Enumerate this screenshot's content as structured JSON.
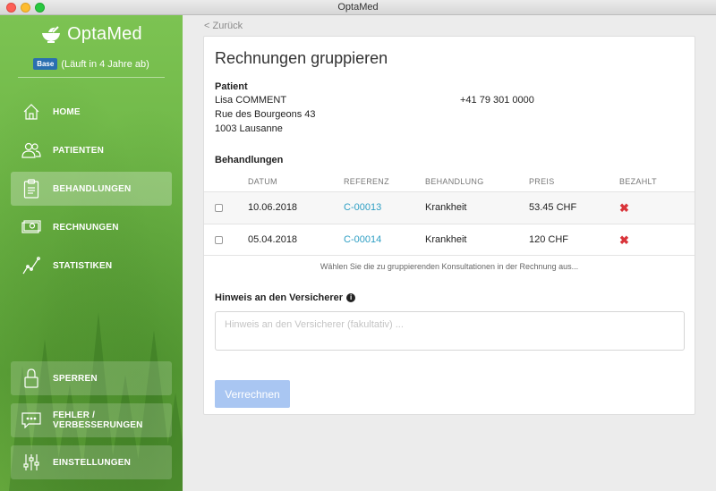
{
  "window": {
    "title": "OptaMed"
  },
  "sidebar": {
    "brand": "OptaMed",
    "license_badge": "Base",
    "license_text": "(Läuft in 4 Jahre ab)",
    "nav": [
      {
        "label": "HOME",
        "icon": "home-icon"
      },
      {
        "label": "PATIENTEN",
        "icon": "patients-icon"
      },
      {
        "label": "BEHANDLUNGEN",
        "icon": "clipboard-icon"
      },
      {
        "label": "RECHNUNGEN",
        "icon": "invoice-icon"
      },
      {
        "label": "STATISTIKEN",
        "icon": "chart-icon"
      }
    ],
    "bottom": [
      {
        "label": "SPERREN",
        "icon": "lock-icon"
      },
      {
        "label": "FEHLER / VERBESSERUNGEN",
        "icon": "feedback-icon"
      },
      {
        "label": "EINSTELLUNGEN",
        "icon": "settings-sliders-icon"
      }
    ],
    "active": "BEHANDLUNGEN"
  },
  "main": {
    "back_label": "< Zurück",
    "title": "Rechnungen gruppieren",
    "patient": {
      "heading": "Patient",
      "name": "Lisa COMMENT",
      "street": "Rue des Bourgeons 43",
      "city": "1003 Lausanne",
      "phone": "+41 79 301 0000"
    },
    "treatments": {
      "heading": "Behandlungen",
      "columns": [
        "DATUM",
        "REFERENZ",
        "BEHANDLUNG",
        "PREIS",
        "BEZAHLT"
      ],
      "rows": [
        {
          "date": "10.06.2018",
          "ref": "C-00013",
          "treatment": "Krankheit",
          "price": "53.45 CHF",
          "paid": false
        },
        {
          "date": "05.04.2018",
          "ref": "C-00014",
          "treatment": "Krankheit",
          "price": "120 CHF",
          "paid": false
        }
      ],
      "hint": "Wählen Sie die zu gruppierenden Konsultationen in der Rechnung aus..."
    },
    "insurer_note": {
      "label": "Hinweis an den Versicherer",
      "placeholder": "Hinweis an den Versicherer (fakultativ) ...",
      "value": ""
    },
    "submit_label": "Verrechnen"
  },
  "colors": {
    "accent": "#2f9fc4",
    "sidebar_green": "#6cb445",
    "button_disabled": "#a9c6f2",
    "unpaid": "#d9343a"
  }
}
